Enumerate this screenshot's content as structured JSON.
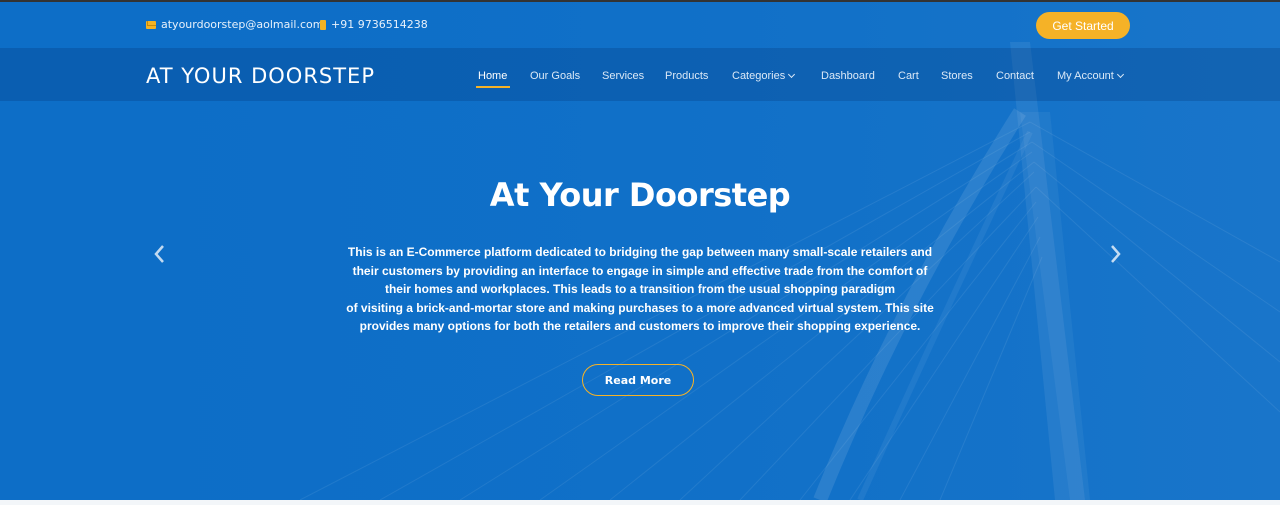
{
  "topbar": {
    "email": "atyourdoorstep@aolmail.com",
    "phone": "+91 9736514238",
    "cta_label": "Get Started"
  },
  "brand": {
    "logo_text": "AT YOUR DOORSTEP"
  },
  "nav": {
    "items": [
      {
        "label": "Home",
        "active": true
      },
      {
        "label": "Our Goals"
      },
      {
        "label": "Services"
      },
      {
        "label": "Products"
      },
      {
        "label": "Categories",
        "dropdown": true
      },
      {
        "label": "Dashboard"
      },
      {
        "label": "Cart"
      },
      {
        "label": "Stores"
      },
      {
        "label": "Contact"
      },
      {
        "label": "My Account",
        "dropdown": true
      }
    ]
  },
  "hero": {
    "title": "At Your Doorstep",
    "lines": [
      "This is an E-Commerce platform dedicated to bridging the gap between many small-scale retailers and",
      "their customers by providing an interface to engage in simple and effective trade from the comfort of",
      "their homes and workplaces. This leads to a transition from the usual shopping paradigm",
      "of visiting a brick-and-mortar store and making purchases to a more advanced virtual system. This site",
      "provides many options for both the retailers and customers to improve their shopping experience."
    ],
    "button_label": "Read More",
    "prev_icon": "chevron-left-icon",
    "next_icon": "chevron-right-icon"
  },
  "colors": {
    "hero_bg": "#0d6ec7",
    "accent": "#f5b227",
    "text": "#ffffff"
  }
}
